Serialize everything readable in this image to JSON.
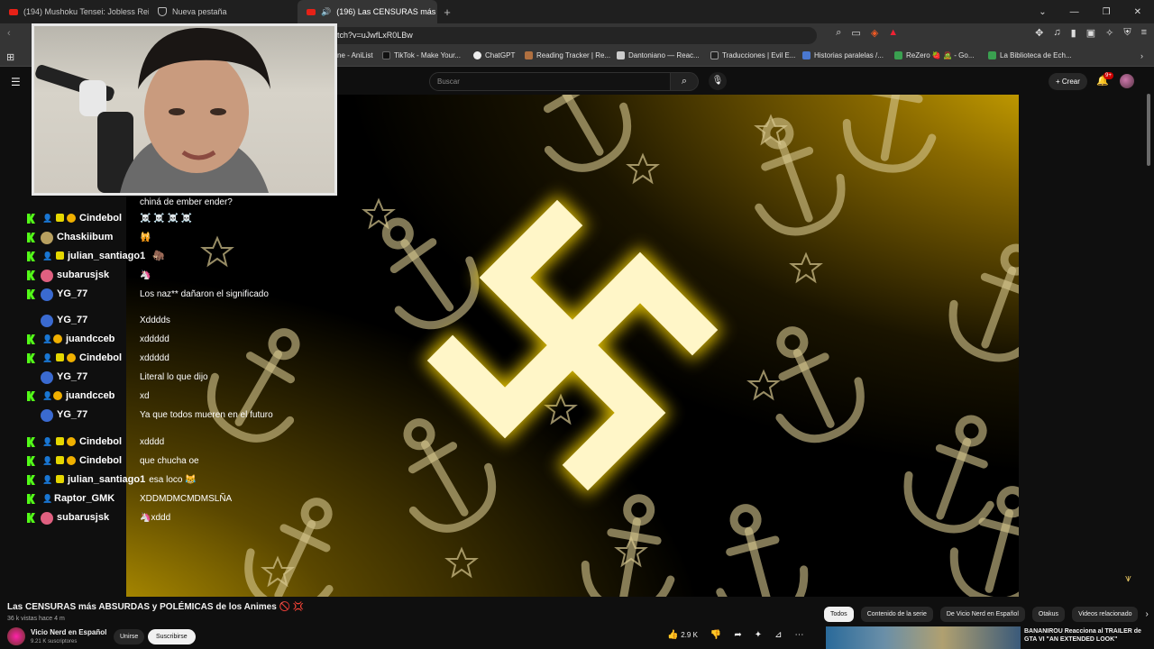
{
  "browser": {
    "tabs": [
      {
        "title": "(194) Mushoku Tensei: Jobless Reinca"
      },
      {
        "title": "Nueva pestaña"
      },
      {
        "title": "(196) Las CENSURAS más ABS"
      }
    ],
    "url": "tch?v=uJwfLxR0LBw",
    "bookmarks": [
      "ne - AniList",
      "TikTok - Make Your...",
      "ChatGPT",
      "Reading Tracker | Re...",
      "Dantoniano — Reac...",
      "Traducciones | Evil E...",
      "Historias paralelas /...",
      "ReZero 🍓 🧟 - Go...",
      "La Biblioteca de Ech..."
    ]
  },
  "youtube": {
    "search_placeholder": "Buscar",
    "create_label": "Crear",
    "notif_count": "9+",
    "video_title": "Las CENSURAS más ABSURDAS y POLÉMICAS de los Animes 🚫 💢",
    "views": "36 k vistas  hace 4 m",
    "channel": "Vicio Nerd en Español",
    "subscribers": "9.21 K suscriptores",
    "join_label": "Unirse",
    "subscribe_label": "Suscribirse",
    "likes": "2.9 K",
    "chips": [
      "Todos",
      "Contenido de la serie",
      "De Vicio Nerd en Español",
      "Otakus",
      "Videos relacionado"
    ],
    "suggestion": "BANANIROU Reacciona al TRAILER de GTA VI \"AN EXTENDED LOOK\""
  },
  "chat": {
    "messages": [
      {
        "user": "",
        "text": "chiná de ember ender?",
        "kick": false,
        "person": false,
        "badge": false,
        "coin": false,
        "avatar": "",
        "color": "#fff"
      },
      {
        "user": "Cindebol",
        "text": "☠️ ☠️ ☠️ ☠️",
        "kick": true,
        "person": true,
        "badge": true,
        "coin": true,
        "avatar": "",
        "color": "#fff"
      },
      {
        "user": "Chaskiibum",
        "text": "🙀",
        "kick": true,
        "person": false,
        "badge": false,
        "coin": false,
        "avatar": "#b8a060",
        "color": "#fff"
      },
      {
        "user": "julian_santiago1",
        "text": "",
        "emote": "🦣",
        "kick": true,
        "person": true,
        "badge": true,
        "coin": false,
        "avatar": "",
        "color": "#fff"
      },
      {
        "user": "subarusjsk",
        "text": "🦄",
        "kick": true,
        "person": false,
        "badge": false,
        "coin": false,
        "avatar": "#e06080",
        "color": "#fff"
      },
      {
        "user": "YG_77",
        "text": "Los naz** dañaron el significado",
        "kick": true,
        "person": false,
        "badge": false,
        "coin": false,
        "avatar": "#3a6ad0",
        "color": "#fff"
      },
      {
        "user": "YG_77",
        "text": "Xdddds",
        "kick": false,
        "person": false,
        "badge": false,
        "coin": false,
        "avatar": "#3a6ad0",
        "color": "#fff"
      },
      {
        "user": "juandcceb",
        "text": "xddddd",
        "kick": true,
        "person": true,
        "badge": false,
        "coin": true,
        "avatar": "",
        "color": "#fff"
      },
      {
        "user": "Cindebol",
        "text": "xddddd",
        "kick": true,
        "person": true,
        "badge": true,
        "coin": true,
        "avatar": "",
        "color": "#fff"
      },
      {
        "user": "YG_77",
        "text": "Literal lo que dijo",
        "kick": false,
        "person": false,
        "badge": false,
        "coin": false,
        "avatar": "#3a6ad0",
        "color": "#fff"
      },
      {
        "user": "juandcceb",
        "text": "xd",
        "kick": true,
        "person": true,
        "badge": false,
        "coin": true,
        "avatar": "",
        "color": "#fff"
      },
      {
        "user": "YG_77",
        "text": "Ya que todos mueren en el futuro",
        "kick": false,
        "person": false,
        "badge": false,
        "coin": false,
        "avatar": "#3a6ad0",
        "color": "#fff"
      },
      {
        "user": "Cindebol",
        "text": "xdddd",
        "kick": true,
        "person": true,
        "badge": true,
        "coin": true,
        "avatar": "",
        "color": "#fff"
      },
      {
        "user": "Cindebol",
        "text": "que chucha oe",
        "kick": true,
        "person": true,
        "badge": true,
        "coin": true,
        "avatar": "",
        "color": "#fff"
      },
      {
        "user": "julian_santiago1",
        "text": "esa loco 😹",
        "kick": true,
        "person": true,
        "badge": true,
        "coin": false,
        "avatar": "",
        "color": "#fff"
      },
      {
        "user": "Raptor_GMK",
        "text": "XDDMDMCMDMSLÑA",
        "kick": true,
        "person": true,
        "badge": false,
        "coin": false,
        "avatar": "",
        "color": "#fff"
      },
      {
        "user": "subarusjsk",
        "text": "🦄xddd",
        "kick": true,
        "person": false,
        "badge": false,
        "coin": false,
        "avatar": "#e06080",
        "color": "#fff"
      }
    ]
  },
  "colors": {
    "accent": "#f1c400",
    "kick_green": "#53fc18",
    "yt_red": "#e62117"
  }
}
